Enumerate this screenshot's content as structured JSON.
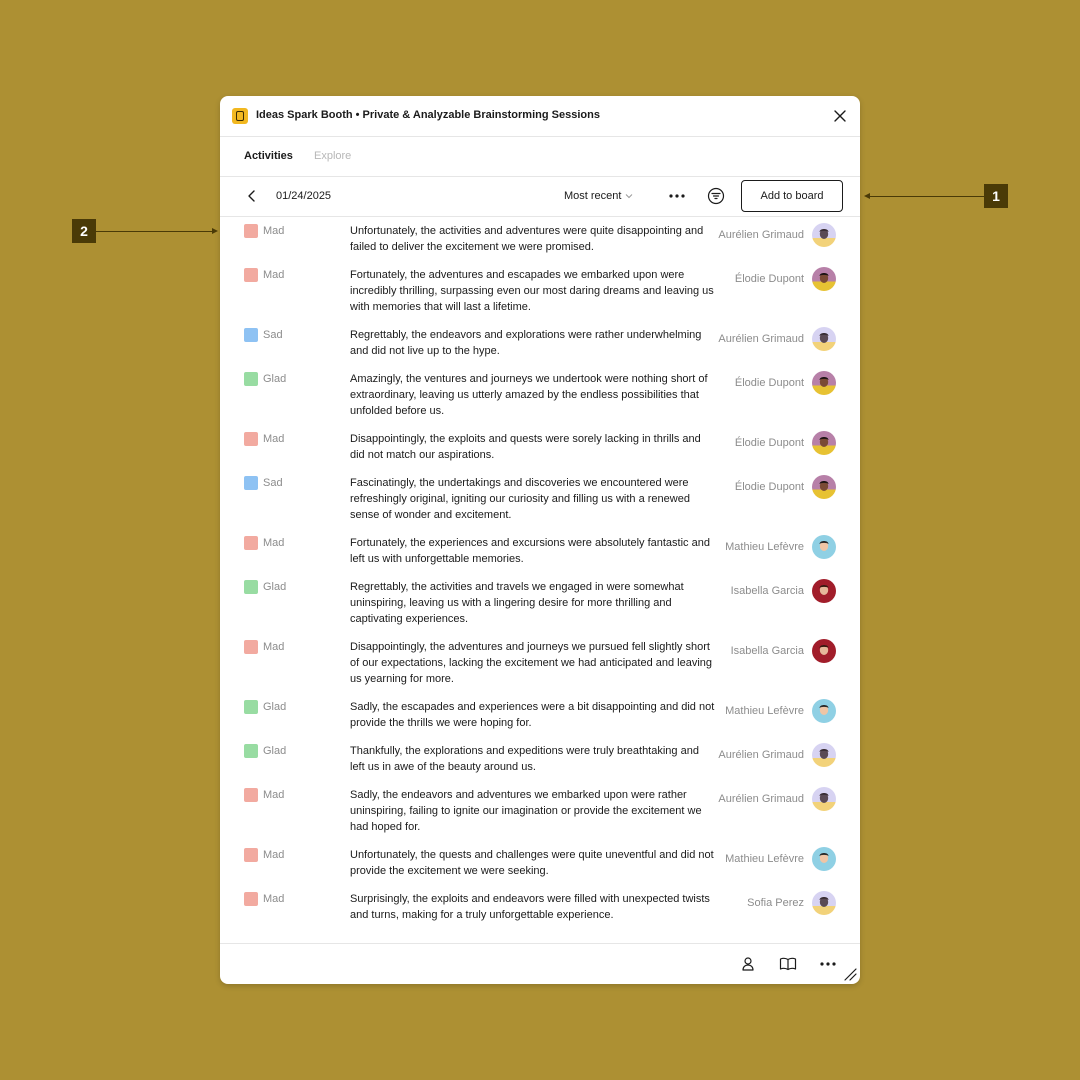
{
  "app": {
    "title": "Ideas Spark Booth • Private & Analyzable Brainstorming Sessions",
    "icon": "booth-app-icon"
  },
  "tabs": [
    {
      "label": "Activities",
      "active": true
    },
    {
      "label": "Explore",
      "active": false
    }
  ],
  "toolbar": {
    "date": "01/24/2025",
    "sort_label": "Most recent",
    "add_label": "Add to board"
  },
  "colors": {
    "background": "#ad9033",
    "mad": "#f2aaa0",
    "sad": "#8ec2f3",
    "glad": "#98dca2",
    "callout": "#4a3a07"
  },
  "callouts": {
    "one": "1",
    "two": "2"
  },
  "entries": [
    {
      "emotion": "Mad",
      "color": "#f2aaa0",
      "text": "Unfortunately, the activities and adventures were quite disappointing and failed to deliver the excitement we were promised.",
      "author": "Aurélien Grimaud",
      "avatar": "aurelien"
    },
    {
      "emotion": "Mad",
      "color": "#f2aaa0",
      "text": "Fortunately, the adventures and escapades we embarked upon were incredibly thrilling, surpassing even our most daring dreams and leaving us with memories that will last a lifetime.",
      "author": "Élodie Dupont",
      "avatar": "elodie"
    },
    {
      "emotion": "Sad",
      "color": "#8ec2f3",
      "text": "Regrettably, the endeavors and explorations were rather underwhelming and did not live up to the hype.",
      "author": "Aurélien Grimaud",
      "avatar": "aurelien"
    },
    {
      "emotion": "Glad",
      "color": "#98dca2",
      "text": "Amazingly, the ventures and journeys we undertook were nothing short of extraordinary, leaving us utterly amazed by the endless possibilities that unfolded before us.",
      "author": "Élodie Dupont",
      "avatar": "elodie"
    },
    {
      "emotion": "Mad",
      "color": "#f2aaa0",
      "text": "Disappointingly, the exploits and quests were sorely lacking in thrills and did not match our aspirations.",
      "author": "Élodie Dupont",
      "avatar": "elodie"
    },
    {
      "emotion": "Sad",
      "color": "#8ec2f3",
      "text": "Fascinatingly, the undertakings and discoveries we encountered were refreshingly original, igniting our curiosity and filling us with a renewed sense of wonder and excitement.",
      "author": "Élodie Dupont",
      "avatar": "elodie"
    },
    {
      "emotion": "Mad",
      "color": "#f2aaa0",
      "text": "Fortunately, the experiences and excursions were absolutely fantastic and left us with unforgettable memories.",
      "author": "Mathieu Lefèvre",
      "avatar": "mathieu"
    },
    {
      "emotion": "Glad",
      "color": "#98dca2",
      "text": "Regrettably, the activities and travels we engaged in were somewhat uninspiring, leaving us with a lingering desire for more thrilling and captivating experiences.",
      "author": "Isabella Garcia",
      "avatar": "isabella"
    },
    {
      "emotion": "Mad",
      "color": "#f2aaa0",
      "text": "Disappointingly, the adventures and journeys we pursued fell slightly short of our expectations, lacking the excitement we had anticipated and leaving us yearning for more.",
      "author": "Isabella Garcia",
      "avatar": "isabella"
    },
    {
      "emotion": "Glad",
      "color": "#98dca2",
      "text": "Sadly, the escapades and experiences were a bit disappointing and did not provide the thrills we were hoping for.",
      "author": "Mathieu Lefèvre",
      "avatar": "mathieu"
    },
    {
      "emotion": "Glad",
      "color": "#98dca2",
      "text": "Thankfully, the explorations and expeditions were truly breathtaking and left us in awe of the beauty around us.",
      "author": "Aurélien Grimaud",
      "avatar": "aurelien"
    },
    {
      "emotion": "Mad",
      "color": "#f2aaa0",
      "text": "Sadly, the endeavors and adventures we embarked upon were rather uninspiring, failing to ignite our imagination or provide the excitement we had hoped for.",
      "author": "Aurélien Grimaud",
      "avatar": "aurelien"
    },
    {
      "emotion": "Mad",
      "color": "#f2aaa0",
      "text": "Unfortunately, the quests and challenges were quite uneventful and did not provide the excitement we were seeking.",
      "author": "Mathieu Lefèvre",
      "avatar": "mathieu"
    },
    {
      "emotion": "Mad",
      "color": "#f2aaa0",
      "text": "Surprisingly, the exploits and endeavors were filled with unexpected twists and turns, making for a truly unforgettable experience.",
      "author": "Sofia Perez",
      "avatar": "sofia"
    }
  ]
}
